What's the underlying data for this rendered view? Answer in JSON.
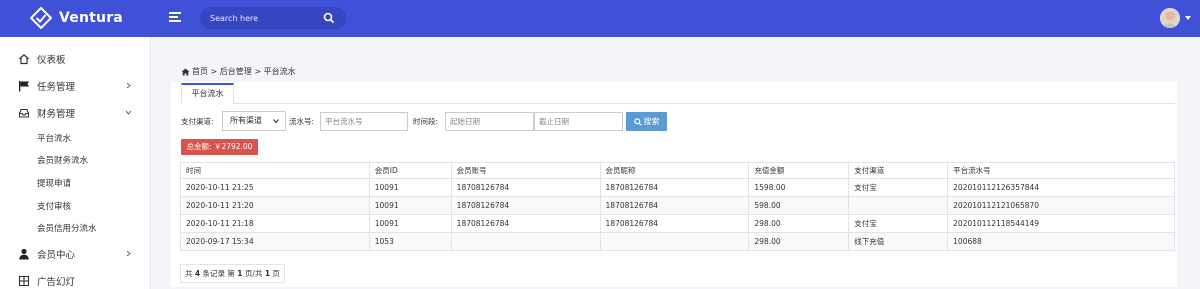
{
  "header": {
    "brand": "Ventura",
    "search_placeholder": "Search here"
  },
  "sidebar": {
    "items": [
      {
        "label": "仪表板",
        "icon": "home-icon"
      },
      {
        "label": "任务管理",
        "icon": "flag-icon"
      },
      {
        "label": "财务管理",
        "icon": "inbox-icon"
      },
      {
        "label": "会员中心",
        "icon": "user-icon"
      },
      {
        "label": "广告幻灯",
        "icon": "grid-icon"
      }
    ],
    "sub_items": [
      "平台流水",
      "会员财务流水",
      "提现申请",
      "支付审核",
      "会员信用分流水"
    ]
  },
  "breadcrumb": "首页 > 后台管理 > 平台流水",
  "tab": "平台流水",
  "filters": {
    "channel_label": "支付渠道:",
    "channel_value": "所有渠道",
    "serial_label": "流水号:",
    "serial_placeholder": "平台流水号",
    "time_label": "时间段:",
    "start_placeholder": "起始日期",
    "end_placeholder": "截止日期",
    "search_button": "搜索"
  },
  "total": "总金额: ￥2792.00",
  "table": {
    "headers": [
      "时间",
      "会员ID",
      "会员账号",
      "会员昵称",
      "充值金额",
      "支付渠道",
      "平台流水号"
    ],
    "rows": [
      [
        "2020-10-11 21:25",
        "10091",
        "18708126784",
        "18708126784",
        "1598.00",
        "支付宝",
        "202010112126357844"
      ],
      [
        "2020-10-11 21:20",
        "10091",
        "18708126784",
        "18708126784",
        "598.00",
        "",
        "202010112121065870"
      ],
      [
        "2020-10-11 21:18",
        "10091",
        "18708126784",
        "18708126784",
        "298.00",
        "支付宝",
        "202010112118544149"
      ],
      [
        "2020-09-17 15:34",
        "1053",
        "",
        "",
        "298.00",
        "线下充值",
        "100688"
      ]
    ]
  },
  "pager": {
    "prefix": "共",
    "count": "4",
    "mid1": "条记录 第",
    "page": "1",
    "mid2": "页/共",
    "pages": "1",
    "suffix": "页"
  }
}
